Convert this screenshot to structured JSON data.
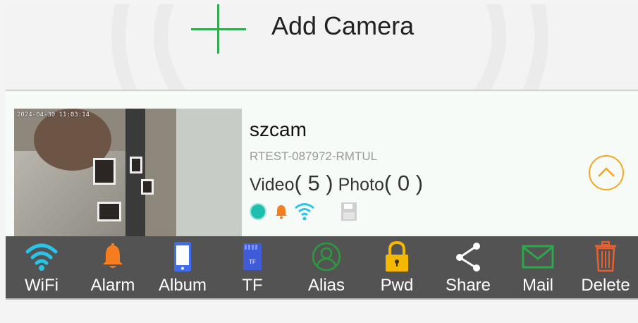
{
  "header": {
    "add_title": "Add Camera"
  },
  "camera": {
    "timestamp": "2024-04-30 11:03:14",
    "name": "szcam",
    "id": "RTEST-087972-RMTUL",
    "video_label": "Video",
    "video_count": "5",
    "photo_label": "Photo",
    "photo_count": "0"
  },
  "icons": {
    "add": "plus-icon",
    "expand": "chevron-up-icon",
    "status": [
      "online-dot-icon",
      "bell-icon",
      "wifi-icon",
      "sd-card-icon"
    ]
  },
  "toolbar": {
    "items": [
      {
        "label": "WiFi",
        "icon": "wifi-icon",
        "color": "#29c4e6"
      },
      {
        "label": "Alarm",
        "icon": "bell-icon",
        "color": "#f57c1f"
      },
      {
        "label": "Album",
        "icon": "phone-icon",
        "color": "#3f6df0"
      },
      {
        "label": "TF",
        "icon": "sd-card-icon",
        "color": "#3f5bd8"
      },
      {
        "label": "Alias",
        "icon": "user-icon",
        "color": "#2a9b3c"
      },
      {
        "label": "Pwd",
        "icon": "lock-icon",
        "color": "#f5b800"
      },
      {
        "label": "Share",
        "icon": "share-icon",
        "color": "#ffffff"
      },
      {
        "label": "Mail",
        "icon": "mail-icon",
        "color": "#2aa84a"
      },
      {
        "label": "Delete",
        "icon": "trash-icon",
        "color": "#e8602c"
      }
    ]
  },
  "colors": {
    "accent_green": "#34a853",
    "accent_orange": "#f5a623",
    "toolbar_bg": "#535353",
    "online_teal": "#1fbfb0",
    "wifi_cyan": "#29c4e6"
  }
}
